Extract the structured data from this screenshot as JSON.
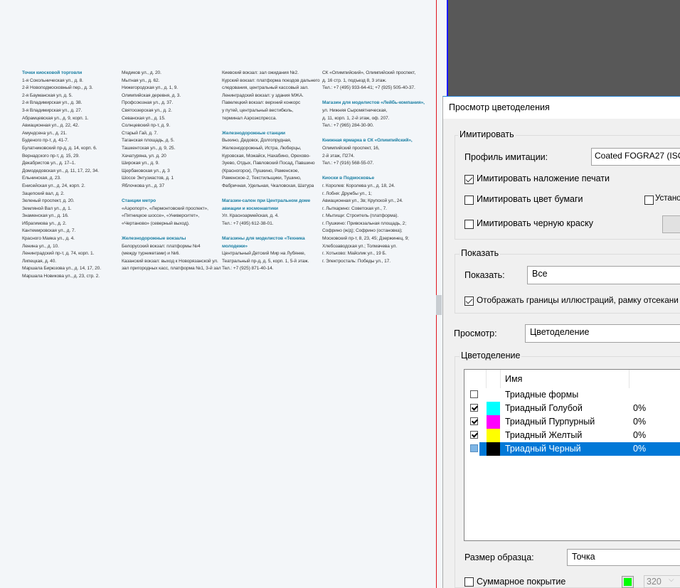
{
  "document": {
    "col1": {
      "heading": "Точки киосковой торговли",
      "lines": [
        "1-я Сокольническая ул., д. 8.",
        "2-й Новоподмосковный пер., д. 3.",
        "2-я Бауманская ул, д. 5.",
        "2-я Владимирская ул., д. 38.",
        "3-я Владимирская ул., д. 27.",
        "Абрамцевская ул., д. 9, корп. 1.",
        "Авиационная ул., д. 22, 42.",
        "Амундсена ул., д. 21.",
        "Буденого пр-т, д. 41-7.",
        "Булатниковский пр-д, д. 14, корп. 6.",
        "Вернадского пр-т, д. 15, 29.",
        "Декабристов ул., д. 17–1.",
        "Домодедовская ул., д. 11, 17, 22, 34.",
        "Ельнинская, д. 23.",
        "Енисейская ул., д. 24, корп. 2.",
        "Зацепский вал, д. 2.",
        "Зеленый проспект, д. 20.",
        "Земляной Вал ул., д. 1.",
        "Знаменская ул., д. 16.",
        "Ибрагимова ул., д. 2.",
        "Кантемировская ул., д. 7.",
        "Красного Маяка ул., д. 4.",
        "Ленина ул., д. 10.",
        "Ленинградский пр-т, д. 74, корп. 1.",
        "Липецкая, д. 40.",
        "Маршала Бирюзова ул., д. 14, 17, 20.",
        "Маршала Новикова ул., д. 23, стр. 2."
      ]
    },
    "col2": {
      "lines": [
        "Медиков ул., д. 20.",
        "Мытная ул., д. 62.",
        "Нижегородская ул., д. 1, 9.",
        "Олимпийская деревня, д. 3.",
        "Профсоюзная ул., д. 37.",
        "Святоозерская ул., д. 2.",
        "Севанская ул., д. 15.",
        "Солнцевский пр-т, д. 9.",
        "Старый Гай, д. 7.",
        "Таганская площадь, д. 5.",
        "Ташкентская ул., д. 9, 25.",
        "Хачатуряна, ул. д. 20",
        "Широкая ул., д. 9.",
        "Щербаковская ул., д. 3",
        "Шоссе Энтузиастов, д. 1",
        "Яблочкова ул., д. 37"
      ],
      "metro_heading": "Станции метро",
      "metro_lines": [
        "«Аэропорт», «Лермонтовский проспект»,",
        "«Пятницкое шоссе», «Университет»,",
        "«Чертаново» (северный выход)."
      ],
      "rail_heading": "Железнодорожные вокзалы",
      "rail_lines": [
        "Белорусский вокзал: платформы №4",
        "(между турникетами) и №6.",
        "Казанский вокзал: выход к Новорязанской ул.",
        "зал пригородных касс, платформа №1, 3-й зал"
      ]
    },
    "col3": {
      "lines": [
        "Киевский вокзал: зал ожидания №2.",
        "Курский вокзал: платформа поездов дальнего",
        "следования, центральный кассовый зал.",
        "Ленинградский вокзал: у здания МЖА.",
        "Павелецкий вокзал: верхний конкорс",
        "у путей, центральный вестибюль,",
        "терминал Аэроэкспресса."
      ],
      "stations_heading": "Железнодорожные станции",
      "stations_lines": [
        "Выхино, Дедовск, Долгопрудная,",
        "Железнодорожный, Истра, Люберцы,",
        "Куровская, Можайск, Нахабино, Орехово-",
        "Зуево, Отдых, Павловский Посад, Павшино",
        "(Красногорск), Пушкино, Раменское,",
        "Раменское-2, Текстильщики, Тушино,",
        "Фабричная, Удельная, Чкаловская, Шатура"
      ],
      "salon_heading": [
        "Магазин-салон при Центральном доме",
        "авиации и космонавтики"
      ],
      "salon_lines": [
        "Ул. Красноармейская, д. 4.",
        "Тел.: +7 (495) 612-38-01."
      ],
      "tm_heading": [
        "Магазины для моделистов «Техника",
        "молодежи»"
      ],
      "tm_lines": [
        "Центральный Детский Мир на Лубянке,",
        "Театральный пр-д, д. 5, корп. 1, 5-й этаж.",
        "Тел.: +7 (925) 871-40-14."
      ]
    },
    "col4": {
      "lines": [
        "СК «Олимпийский», Олимпийский проспект,",
        "д. 16 стр. 1, подъезд 8, 3 этаж.",
        "Тел.: +7 (495) 933-64-41; +7 (925) 505-40-37."
      ],
      "lb_heading": "Магазин для моделистов «Лейбь-компания»,",
      "lb_lines": [
        "ул. Нижняя Сыромятническая,",
        "д. 11, корп. 1, 2-й этаж, оф. 207.",
        "Тел.: +7 (965) 284-30-90."
      ],
      "book_heading": "Книжная ярмарка в СК «Олимпийский»,",
      "book_lines": [
        "Олимпийский проспект, 16,",
        "2-й этаж, П274.",
        "Тел.: +7 (916) 568-55-07."
      ],
      "kiosk_heading": "Киоски в Подмосковье",
      "kiosk_lines": [
        "г. Королев: Королева ул., д. 18, 24.",
        "г. Лобня: Дружбы ул., 1;",
        "Авиационная ул., 3в; Крупской ул., 24.",
        "г. Лыткарино: Советская ул., 7.",
        "г. Мытищи: Строитель (платформа).",
        "г. Пушкино: Привокзальная площадь, 2;",
        "Софрино (ж/д); Софрино (остановка);",
        "Московский пр-т, 8, 23, 45; Дзержинец, 9;",
        "Хлебозаводская ул.; Толмачева ул.",
        "г. Хотьково: Майолик ул., 19 Б.",
        "г. Электросталь: Победы ул., 17."
      ]
    }
  },
  "dialog": {
    "title": "Просмотр цветоделения",
    "simulate": {
      "legend": "Имитировать",
      "profile_label": "Профиль имитации:",
      "profile_value": "Coated FOGRA27 (ISO 1",
      "overprint_label": "Имитировать наложение печати",
      "overprint_checked": true,
      "paper_label": "Имитировать цвет бумаги",
      "paper_checked": false,
      "set_label": "Устано",
      "set_checked": false,
      "black_label": "Имитировать черную краску",
      "black_checked": false
    },
    "show": {
      "legend": "Показать",
      "show_label": "Показать:",
      "show_value": "Все",
      "bounds_label": "Отображать границы иллюстраций, рамку отсекани",
      "bounds_checked": true
    },
    "preview_label": "Просмотр:",
    "preview_value": "Цветоделение",
    "separations": {
      "legend": "Цветоделение",
      "header_name": "Имя",
      "rows": [
        {
          "name": "Триадные формы",
          "pct": "",
          "checked": false,
          "color": ""
        },
        {
          "name": "Триадный Голубой",
          "pct": "0%",
          "checked": true,
          "color": "#00ffff"
        },
        {
          "name": "Триадный Пурпурный",
          "pct": "0%",
          "checked": true,
          "color": "#ff00ff"
        },
        {
          "name": "Триадный Желтый",
          "pct": "0%",
          "checked": true,
          "color": "#ffff00"
        },
        {
          "name": "Триадный Черный",
          "pct": "0%",
          "checked": false,
          "color": "#000000",
          "selected": true
        }
      ]
    },
    "sample_label": "Размер образца:",
    "sample_value": "Точка",
    "coverage_label": "Суммарное покрытие",
    "coverage_checked": false,
    "coverage_color": "#00ff00",
    "coverage_value": "320"
  }
}
